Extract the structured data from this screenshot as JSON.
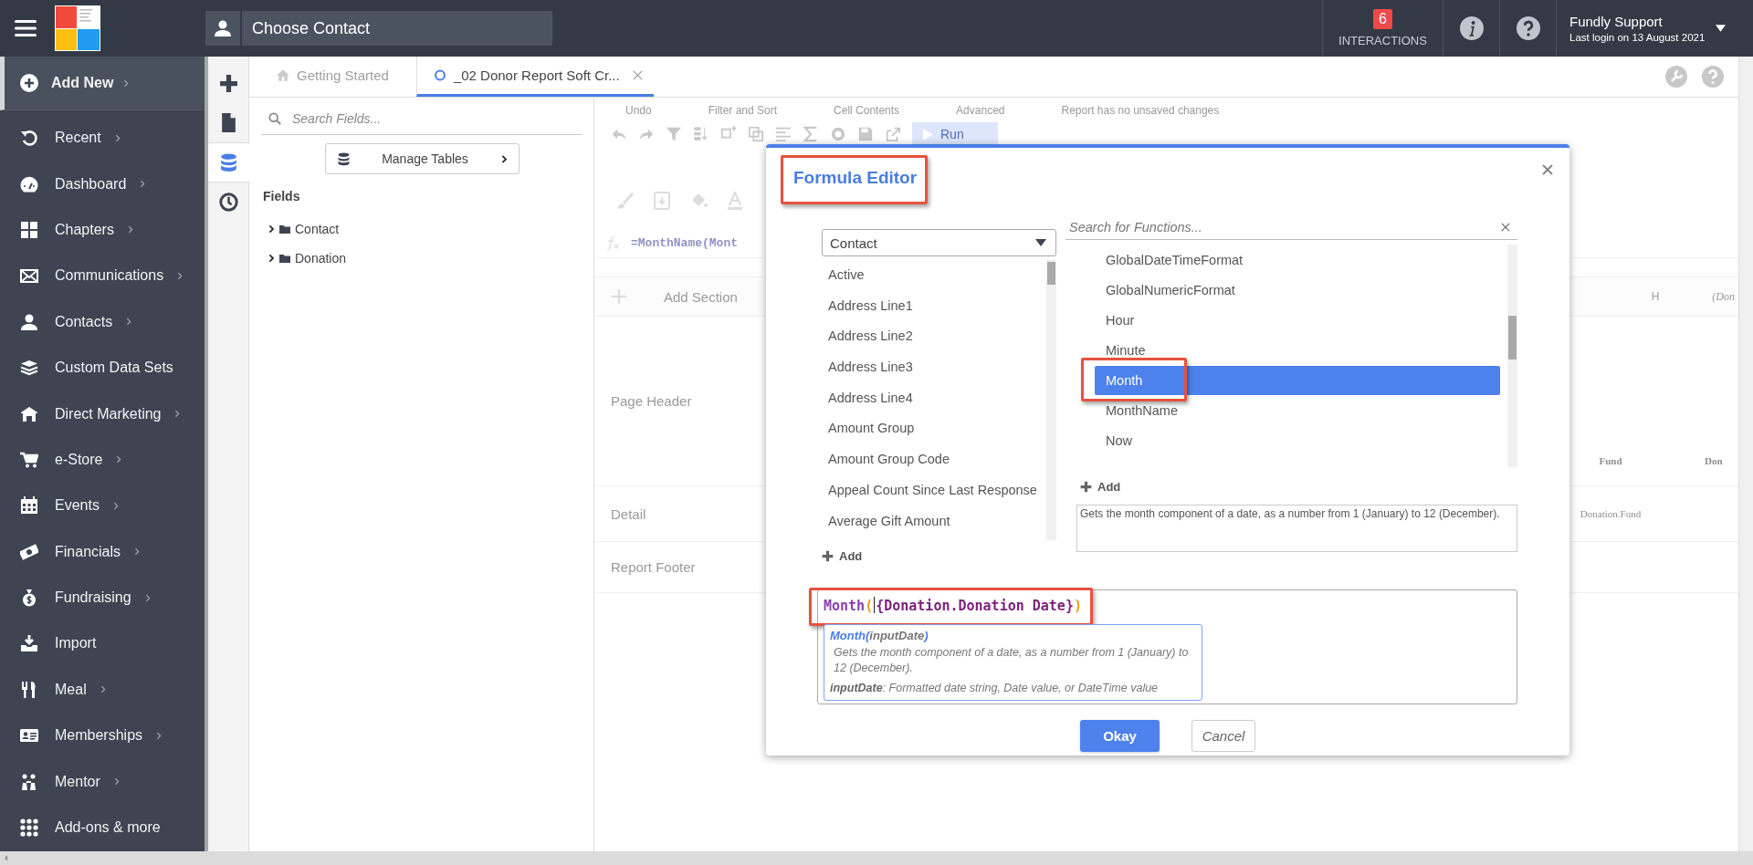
{
  "topbar": {
    "contact_search": {
      "placeholder": "Choose Contact"
    },
    "interactions": {
      "count": "6",
      "label": "INTERACTIONS"
    },
    "user": {
      "name": "Fundly Support",
      "last_login": "Last login on 13 August 2021"
    }
  },
  "sidebar": {
    "add_new": {
      "label": "Add New",
      "selected": true
    },
    "items": [
      {
        "label": "Recent",
        "has_submenu": true
      },
      {
        "label": "Dashboard",
        "has_submenu": true
      },
      {
        "label": "Chapters",
        "has_submenu": true
      },
      {
        "label": "Communications",
        "has_submenu": true
      },
      {
        "label": "Contacts",
        "has_submenu": true
      },
      {
        "label": "Custom Data Sets",
        "has_submenu": false
      },
      {
        "label": "Direct Marketing",
        "has_submenu": true
      },
      {
        "label": "e-Store",
        "has_submenu": true
      },
      {
        "label": "Events",
        "has_submenu": true
      },
      {
        "label": "Financials",
        "has_submenu": true
      },
      {
        "label": "Fundraising",
        "has_submenu": true
      },
      {
        "label": "Import",
        "has_submenu": false
      },
      {
        "label": "Meal",
        "has_submenu": true
      },
      {
        "label": "Memberships",
        "has_submenu": true
      },
      {
        "label": "Mentor",
        "has_submenu": true
      }
    ],
    "footer": {
      "label": "Add-ons & more"
    }
  },
  "rail": {
    "items": [
      {
        "selected": false
      },
      {
        "selected": false
      },
      {
        "selected": true
      },
      {
        "selected": false
      }
    ]
  },
  "tabs": [
    {
      "kind": "home",
      "label": "Getting Started",
      "selected": false
    },
    {
      "kind": "report",
      "label": "_02 Donor Report Soft Cr...",
      "selected": true
    }
  ],
  "fields_panel": {
    "search": {
      "placeholder": "Search Fields..."
    },
    "manage_button": "Manage Tables",
    "heading": "Fields",
    "tree": [
      {
        "label": "Contact",
        "expanded": false
      },
      {
        "label": "Donation",
        "expanded": false
      }
    ]
  },
  "report_designer": {
    "toolbar_groups": [
      "Undo",
      "Filter and Sort",
      "Cell Contents",
      "Advanced"
    ],
    "status": "Report has no unsaved changes",
    "run_button": "Run",
    "formula": "=MonthName(Mont",
    "add_section": "Add Section",
    "section_bar_cells": [
      "H",
      "(Don"
    ],
    "sections": [
      {
        "label": "Page Header",
        "cells": [
          "Fund",
          "Don"
        ]
      },
      {
        "label": "Detail",
        "cells": [
          "Donation.Fund"
        ]
      },
      {
        "label": "Report Footer"
      }
    ]
  },
  "formula_editor": {
    "title": "Formula Editor",
    "title_highlighted": true,
    "table_select": "Contact",
    "fields": [
      "Active",
      "Address Line1",
      "Address Line2",
      "Address Line3",
      "Address Line4",
      "Amount Group",
      "Amount Group Code",
      "Appeal Count Since Last Response",
      "Average Gift Amount"
    ],
    "add_field_label": "Add",
    "function_search": {
      "placeholder": "Search for Functions..."
    },
    "functions": [
      {
        "label": "GlobalDateTimeFormat",
        "selected": false,
        "highlighted": false
      },
      {
        "label": "GlobalNumericFormat",
        "selected": false,
        "highlighted": false
      },
      {
        "label": "Hour",
        "selected": false,
        "highlighted": false
      },
      {
        "label": "Minute",
        "selected": false,
        "highlighted": false
      },
      {
        "label": "Month",
        "selected": true,
        "highlighted": true
      },
      {
        "label": "MonthName",
        "selected": false,
        "highlighted": false
      },
      {
        "label": "Now",
        "selected": false,
        "highlighted": false
      }
    ],
    "add_function_label": "Add",
    "function_description": "Gets the month component of a date, as a number from 1 (January) to 12 (December).",
    "formula": {
      "highlighted": true,
      "tokens": [
        {
          "kind": "function",
          "text": "Month"
        },
        {
          "kind": "paren",
          "text": "("
        },
        {
          "kind": "cursor"
        },
        {
          "kind": "field",
          "text": "{Donation.Donation Date}"
        },
        {
          "kind": "paren",
          "text": ")"
        }
      ]
    },
    "tooltip": {
      "signature": [
        {
          "kind": "name",
          "text": "Month"
        },
        {
          "kind": "paren",
          "text": "("
        },
        {
          "kind": "param",
          "text": "inputDate"
        },
        {
          "kind": "paren",
          "text": ")"
        }
      ],
      "description": "Gets the month component of a date, as a number from 1 (January) to 12 (December).",
      "parameter": "**inputDate**: Formatted date string, Date value, or DateTime value"
    },
    "buttons": [
      {
        "label": "Okay",
        "kind": "primary"
      },
      {
        "label": "Cancel",
        "kind": "secondary"
      }
    ]
  }
}
